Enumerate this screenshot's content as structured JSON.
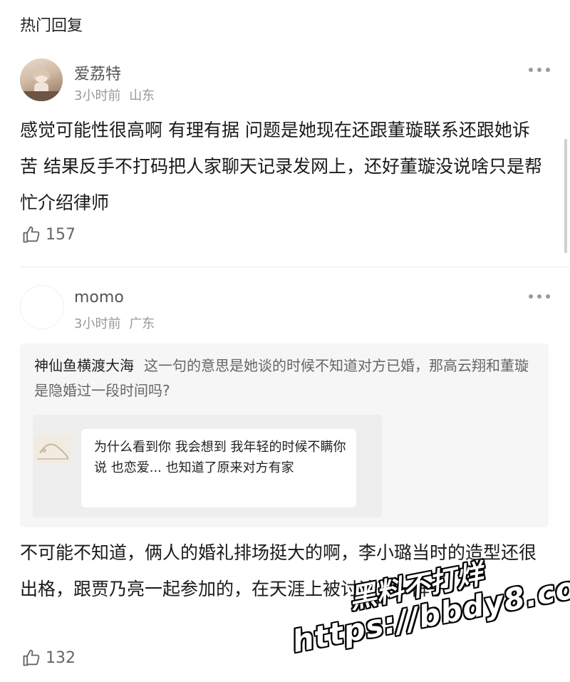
{
  "section_title": "热门回复",
  "comments": [
    {
      "username": "爱荔特",
      "time": "3小时前",
      "location": "山东",
      "text": "感觉可能性很高啊 有理有据 问题是她现在还跟董璇联系还跟她诉苦 结果反手不打码把人家聊天记录发网上，还好董璇没说啥只是帮忙介绍律师",
      "likes": "157"
    },
    {
      "username": "momo",
      "time": "3小时前",
      "location": "广东",
      "quote": {
        "author": "神仙鱼横渡大海",
        "text": "这一句的意思是她谈的时候不知道对方已婚，那高云翔和董璇是隐婚过一段时间吗?",
        "chat_bubble": "为什么看到你 我会想到 我年轻的时候不瞒你说 也恋爱... 也知道了原来对方有家"
      },
      "text": "不可能不知道，俩人的婚礼排场挺大的啊，李小璐当时的造型还很出格，跟贾乃亮一起参加的，在天涯上被讨论了一阵子",
      "likes": "132"
    }
  ],
  "watermark": {
    "line1": "黑料不打烊",
    "line2": "https://bbdy8.com"
  },
  "colors": {
    "text": "#1a1a1a",
    "meta": "#999999",
    "quote_bg": "#f6f6f6"
  }
}
